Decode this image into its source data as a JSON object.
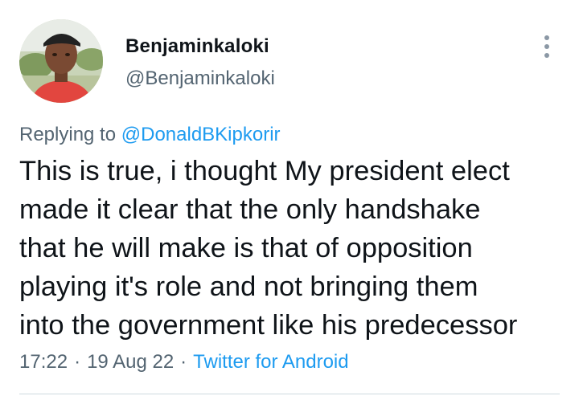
{
  "author": {
    "display_name": "Benjaminkaloki",
    "handle": "@Benjaminkaloki"
  },
  "reply": {
    "prefix": "Replying to",
    "mention": "@DonaldBKipkorir"
  },
  "tweet": {
    "lines": [
      "This is true, i thought My president elect",
      "made it clear that the only handshake",
      "that he will make is that of opposition",
      "playing it's role and not bringing them",
      "into the government like his predecessor"
    ]
  },
  "meta": {
    "time": "17:22",
    "separator": "·",
    "date": "19 Aug 22",
    "source": "Twitter for Android"
  },
  "icons": {
    "more": "more-vertical-icon",
    "avatar": "profile-photo"
  },
  "colors": {
    "link": "#1d9bf0",
    "secondary_text": "#536471",
    "primary_text": "#0f1419"
  }
}
